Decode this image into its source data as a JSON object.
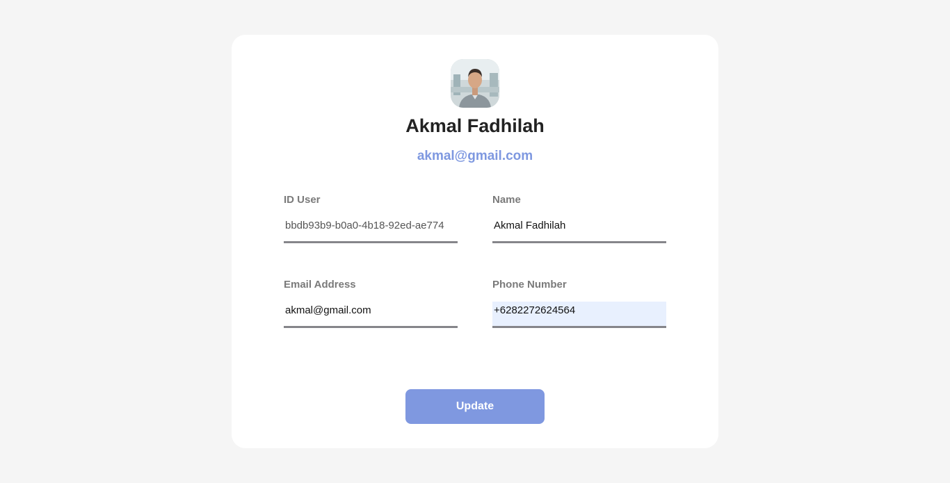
{
  "profile": {
    "name": "Akmal Fadhilah",
    "email": "akmal@gmail.com"
  },
  "form": {
    "id_user": {
      "label": "ID User",
      "value": "bbdb93b9-b0a0-4b18-92ed-ae774"
    },
    "name": {
      "label": "Name",
      "value": "Akmal Fadhilah"
    },
    "email": {
      "label": "Email Address",
      "value": "akmal@gmail.com"
    },
    "phone": {
      "label": "Phone Number",
      "value": "+6282272624564"
    }
  },
  "actions": {
    "update_label": "Update"
  },
  "colors": {
    "accent": "#7f98e0",
    "page_background": "#f5f5f5",
    "card_background": "#ffffff"
  }
}
